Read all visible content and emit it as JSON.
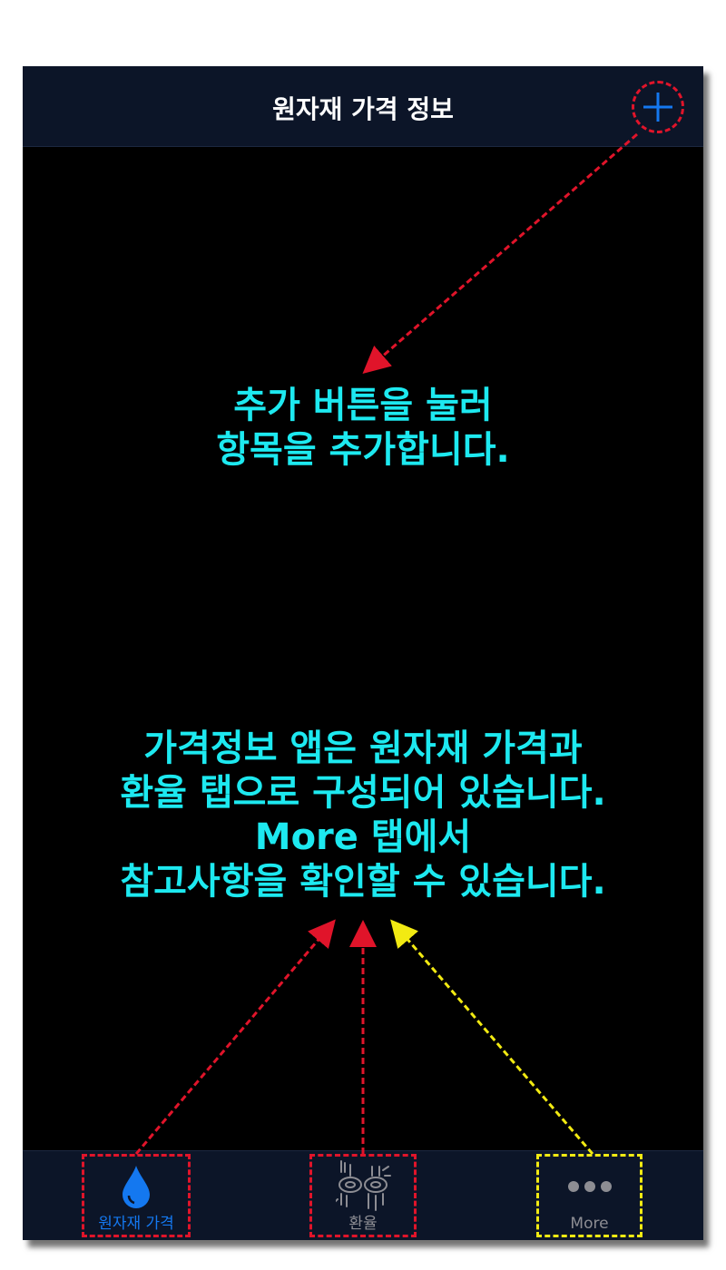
{
  "navbar": {
    "title": "원자재 가격 정보"
  },
  "hints": {
    "add_hint": [
      "추가 버튼을 눌러",
      "항목을 추가합니다."
    ],
    "tabs_hint": [
      "가격정보 앱은 원자재 가격과",
      "환율 탭으로 구성되어 있습니다.",
      "More 탭에서",
      "참고사항을 확인할 수 있습니다."
    ]
  },
  "tabs": [
    {
      "label": "원자재 가격",
      "icon": "water-drop-icon",
      "active": true
    },
    {
      "label": "환율",
      "icon": "currency-exchange-icon",
      "active": false
    },
    {
      "label": "More",
      "icon": "more-dots-icon",
      "active": false
    }
  ],
  "colors": {
    "accent": "#1478f0",
    "hint_text": "#1de9f0",
    "annotation_red": "#e0142a",
    "annotation_yellow": "#f2ea12",
    "bar_background": "#0c1528"
  }
}
